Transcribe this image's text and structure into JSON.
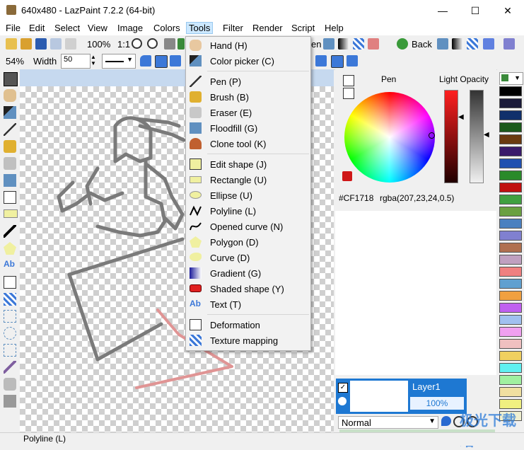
{
  "window": {
    "title": "640x480 - LazPaint 7.2.2 (64-bit)",
    "minimize": "—",
    "maximize": "☐",
    "close": "✕"
  },
  "menu": [
    "File",
    "Edit",
    "Select",
    "View",
    "Image",
    "Colors",
    "Tools",
    "Filter",
    "Render",
    "Script",
    "Help"
  ],
  "toolbar": {
    "zoom_percent": "100%",
    "zoom_ratio": "1:1",
    "back_label": "Back",
    "partial_label": "en"
  },
  "toolbar2": {
    "zoom": "54%",
    "width_label": "Width",
    "width_value": "50"
  },
  "tools_menu": {
    "items": [
      {
        "label": "Hand (H)",
        "icon": "hand-icon"
      },
      {
        "label": "Color picker (C)",
        "icon": "color-picker-icon"
      },
      {
        "label": "Pen (P)",
        "icon": "pen-icon"
      },
      {
        "label": "Brush (B)",
        "icon": "brush-icon"
      },
      {
        "label": "Eraser (E)",
        "icon": "eraser-icon"
      },
      {
        "label": "Floodfill (G)",
        "icon": "floodfill-icon"
      },
      {
        "label": "Clone tool (K)",
        "icon": "clone-icon"
      },
      {
        "label": "Edit shape (J)",
        "icon": "edit-shape-icon"
      },
      {
        "label": "Rectangle (U)",
        "icon": "rectangle-icon"
      },
      {
        "label": "Ellipse (U)",
        "icon": "ellipse-icon"
      },
      {
        "label": "Polyline (L)",
        "icon": "polyline-icon"
      },
      {
        "label": "Opened curve (N)",
        "icon": "opened-curve-icon"
      },
      {
        "label": "Polygon (D)",
        "icon": "polygon-icon"
      },
      {
        "label": "Curve (D)",
        "icon": "curve-icon"
      },
      {
        "label": "Gradient (G)",
        "icon": "gradient-icon"
      },
      {
        "label": "Shaded shape (Y)",
        "icon": "shaded-shape-icon"
      },
      {
        "label": "Text (T)",
        "icon": "text-icon"
      },
      {
        "label": "Deformation",
        "icon": "deformation-icon"
      },
      {
        "label": "Texture mapping",
        "icon": "texture-mapping-icon"
      }
    ]
  },
  "color_panel": {
    "pen_label": "Pen",
    "opacity_label": "Light Opacity",
    "hex": "#CF1718",
    "rgba": "rgba(207,23,24,0.5)",
    "pen_color": "#CF1718"
  },
  "layer": {
    "name": "Layer1",
    "opacity": "100%"
  },
  "blend_mode": "Normal",
  "status": "Polyline (L)",
  "watermark": "极光下载站",
  "palette": [
    "#000000",
    "#1a1a3a",
    "#10306b",
    "#1b5a1b",
    "#6a3a10",
    "#3a1a6a",
    "#2050b0",
    "#2a8a2a",
    "#c01010",
    "#40a040",
    "#6aa040",
    "#4a80c0",
    "#8080d0",
    "#b07050",
    "#c0a0c0",
    "#f08080",
    "#60a0d0",
    "#f0a040",
    "#c060f0",
    "#a0c0f0",
    "#f0a0f0",
    "#f0c0c0",
    "#f0d060",
    "#60f0f0",
    "#a0f0a0",
    "#f0e0a0",
    "#f0f080",
    "#f0f0d0"
  ]
}
